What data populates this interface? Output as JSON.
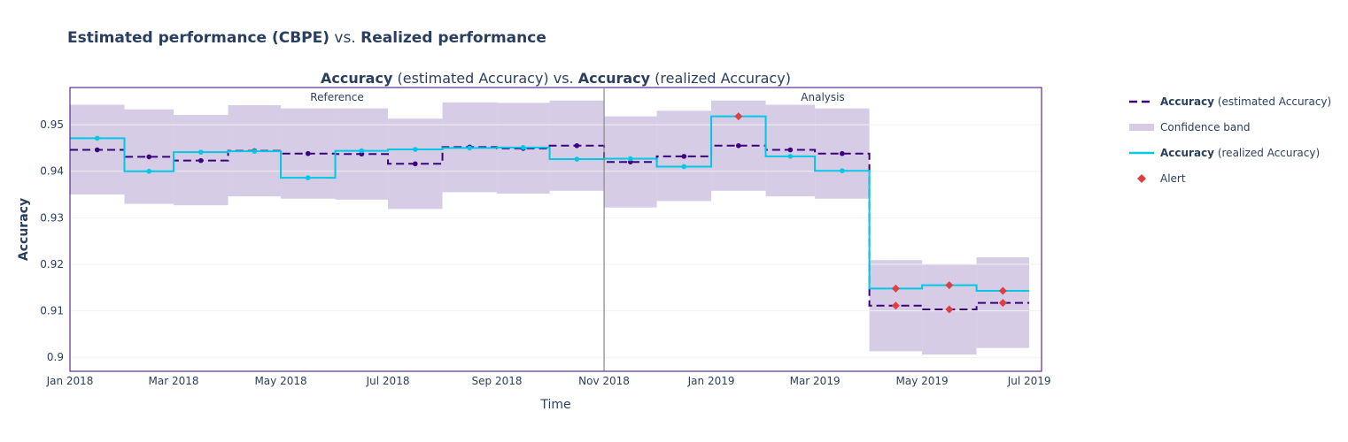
{
  "title": {
    "part1_bold": "Estimated performance (CBPE)",
    "part2": " vs. ",
    "part3_bold": "Realized performance"
  },
  "chart_data": {
    "type": "line",
    "subplot_title": {
      "bold1": "Accuracy",
      "plain1": " (estimated Accuracy) vs. ",
      "bold2": "Accuracy",
      "plain2": " (realized Accuracy)"
    },
    "xlabel": "Time",
    "ylabel": "Accuracy",
    "ylim": [
      0.897,
      0.958
    ],
    "yticks": [
      0.9,
      0.91,
      0.92,
      0.93,
      0.94,
      0.95
    ],
    "ytick_labels": [
      "0.9",
      "0.91",
      "0.92",
      "0.93",
      "0.94",
      "0.95"
    ],
    "xlim": [
      "2018-01-01",
      "2019-07-08"
    ],
    "xticks": [
      "2018-01-01",
      "2018-03-01",
      "2018-05-01",
      "2018-07-01",
      "2018-09-01",
      "2018-11-01",
      "2019-01-01",
      "2019-03-01",
      "2019-05-01",
      "2019-07-01"
    ],
    "xtick_labels": [
      "Jan 2018",
      "Mar 2018",
      "May 2018",
      "Jul 2018",
      "Sep 2018",
      "Nov 2018",
      "Jan 2019",
      "Mar 2019",
      "May 2019",
      "Jul 2019"
    ],
    "period_boundary": "2018-11-01",
    "period_labels": [
      "Reference",
      "Analysis"
    ],
    "chunk_edges": [
      "2018-01-01",
      "2018-02-01",
      "2018-03-01",
      "2018-04-01",
      "2018-05-01",
      "2018-06-01",
      "2018-07-01",
      "2018-08-01",
      "2018-09-01",
      "2018-10-01",
      "2018-11-01",
      "2018-12-01",
      "2019-01-01",
      "2019-02-01",
      "2019-03-01",
      "2019-04-01",
      "2019-05-01",
      "2019-06-01",
      "2019-07-01"
    ],
    "series": [
      {
        "name": "Accuracy (estimated Accuracy)",
        "name_bold": "Accuracy",
        "name_rest": " (estimated Accuracy)",
        "style": "dashed",
        "color": "#3b0280",
        "values": [
          0.9446,
          0.9431,
          0.9423,
          0.9444,
          0.9438,
          0.9437,
          0.9416,
          0.9452,
          0.9449,
          0.9455,
          0.942,
          0.9432,
          0.9455,
          0.9446,
          0.9438,
          0.9111,
          0.9103,
          0.9117
        ]
      },
      {
        "name": "Accuracy (realized Accuracy)",
        "name_bold": "Accuracy",
        "name_rest": " (realized Accuracy)",
        "style": "solid",
        "color": "#00c8e5",
        "values": [
          0.9471,
          0.94,
          0.9441,
          0.9443,
          0.9386,
          0.9444,
          0.9447,
          0.945,
          0.9451,
          0.9426,
          0.9427,
          0.941,
          0.9518,
          0.9432,
          0.9401,
          0.9148,
          0.9155,
          0.9143
        ]
      }
    ],
    "confidence_band": {
      "name": "Confidence band",
      "color": "#d6cce6",
      "upper": [
        0.9543,
        0.9533,
        0.9521,
        0.9542,
        0.9535,
        0.9535,
        0.9513,
        0.9548,
        0.9547,
        0.9552,
        0.9518,
        0.953,
        0.9552,
        0.9543,
        0.9535,
        0.9209,
        0.92,
        0.9215
      ],
      "lower": [
        0.935,
        0.933,
        0.9327,
        0.9346,
        0.9341,
        0.9339,
        0.9319,
        0.9355,
        0.9352,
        0.9358,
        0.9322,
        0.9336,
        0.9358,
        0.9346,
        0.9341,
        0.9013,
        0.9006,
        0.902
      ]
    },
    "alerts": {
      "name": "Alert",
      "color": "#dd4040",
      "chunk_indices_estimated": [
        15,
        16,
        17
      ],
      "chunk_indices_realized": [
        12,
        15,
        16,
        17
      ]
    },
    "legend_position": "right"
  }
}
